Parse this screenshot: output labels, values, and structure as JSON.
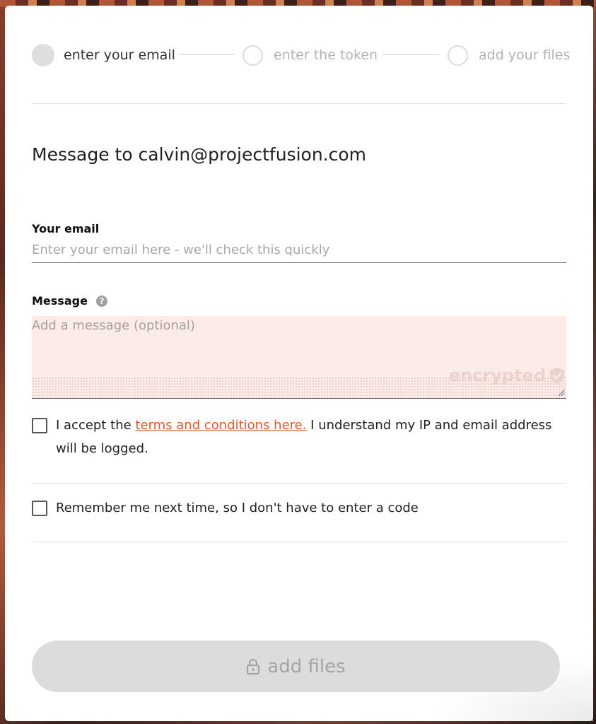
{
  "stepper": {
    "steps": [
      {
        "label": "enter your email",
        "active": true
      },
      {
        "label": "enter the token",
        "active": false
      },
      {
        "label": "add your files",
        "active": false
      }
    ]
  },
  "form": {
    "title": "Message to calvin@projectfusion.com",
    "email": {
      "label": "Your email",
      "placeholder": "Enter your email here - we'll check this quickly",
      "value": ""
    },
    "message": {
      "label": "Message",
      "help_icon": "question-circle-icon",
      "placeholder": "Add a message (optional)",
      "value": "",
      "encrypted_label": "encrypted",
      "encrypted_icon": "shield-check-icon"
    },
    "terms": {
      "checked": false,
      "text_before": "I accept the ",
      "link_text": "terms and conditions here.",
      "text_after": " I understand my IP and email address will be logged."
    },
    "remember": {
      "checked": false,
      "text": "Remember me next time, so I don't have to enter a code"
    },
    "submit": {
      "label": "add files",
      "icon": "lock-icon",
      "disabled": true
    }
  },
  "colors": {
    "link": "#e8572a",
    "message_bg": "#fdebe7",
    "button_disabled_bg": "#dcdcdc"
  }
}
